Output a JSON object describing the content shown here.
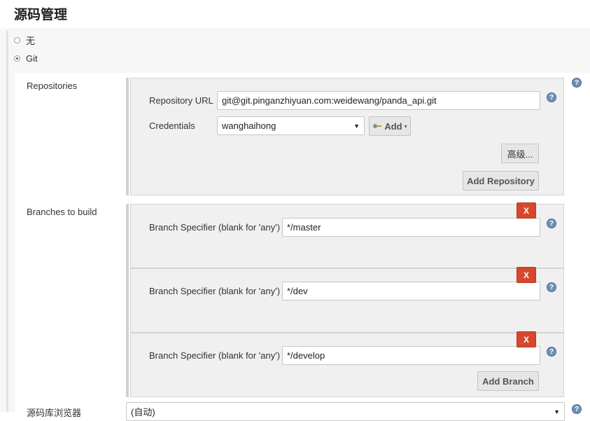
{
  "section": {
    "title": "源码管理"
  },
  "scm_options": [
    {
      "label": "无",
      "checked": false
    },
    {
      "label": "Git",
      "checked": true
    }
  ],
  "repositories": {
    "label": "Repositories",
    "url_label": "Repository URL",
    "url_value": "git@git.pinganzhiyuan.com:weidewang/panda_api.git",
    "credentials_label": "Credentials",
    "credentials_value": "wanghaihong",
    "add_button": "Add",
    "advanced_button": "高级...",
    "add_repository_button": "Add Repository"
  },
  "branches": {
    "label": "Branches to build",
    "items": [
      {
        "label": "Branch Specifier (blank for 'any')",
        "value": "*/master",
        "delete": "X"
      },
      {
        "label": "Branch Specifier (blank for 'any')",
        "value": "*/dev",
        "delete": "X"
      },
      {
        "label": "Branch Specifier (blank for 'any')",
        "value": "*/develop",
        "delete": "X"
      }
    ],
    "add_branch_button": "Add Branch"
  },
  "browser": {
    "label": "源码库浏览器",
    "value": "(自动)"
  },
  "help_glyph": "?",
  "icons": {
    "key": "key-icon",
    "help": "help-icon",
    "delete": "delete-icon",
    "dropdown": "chevron-down-icon"
  },
  "colors": {
    "delete_red": "#d6472b",
    "help_blue": "#6f90b5"
  }
}
